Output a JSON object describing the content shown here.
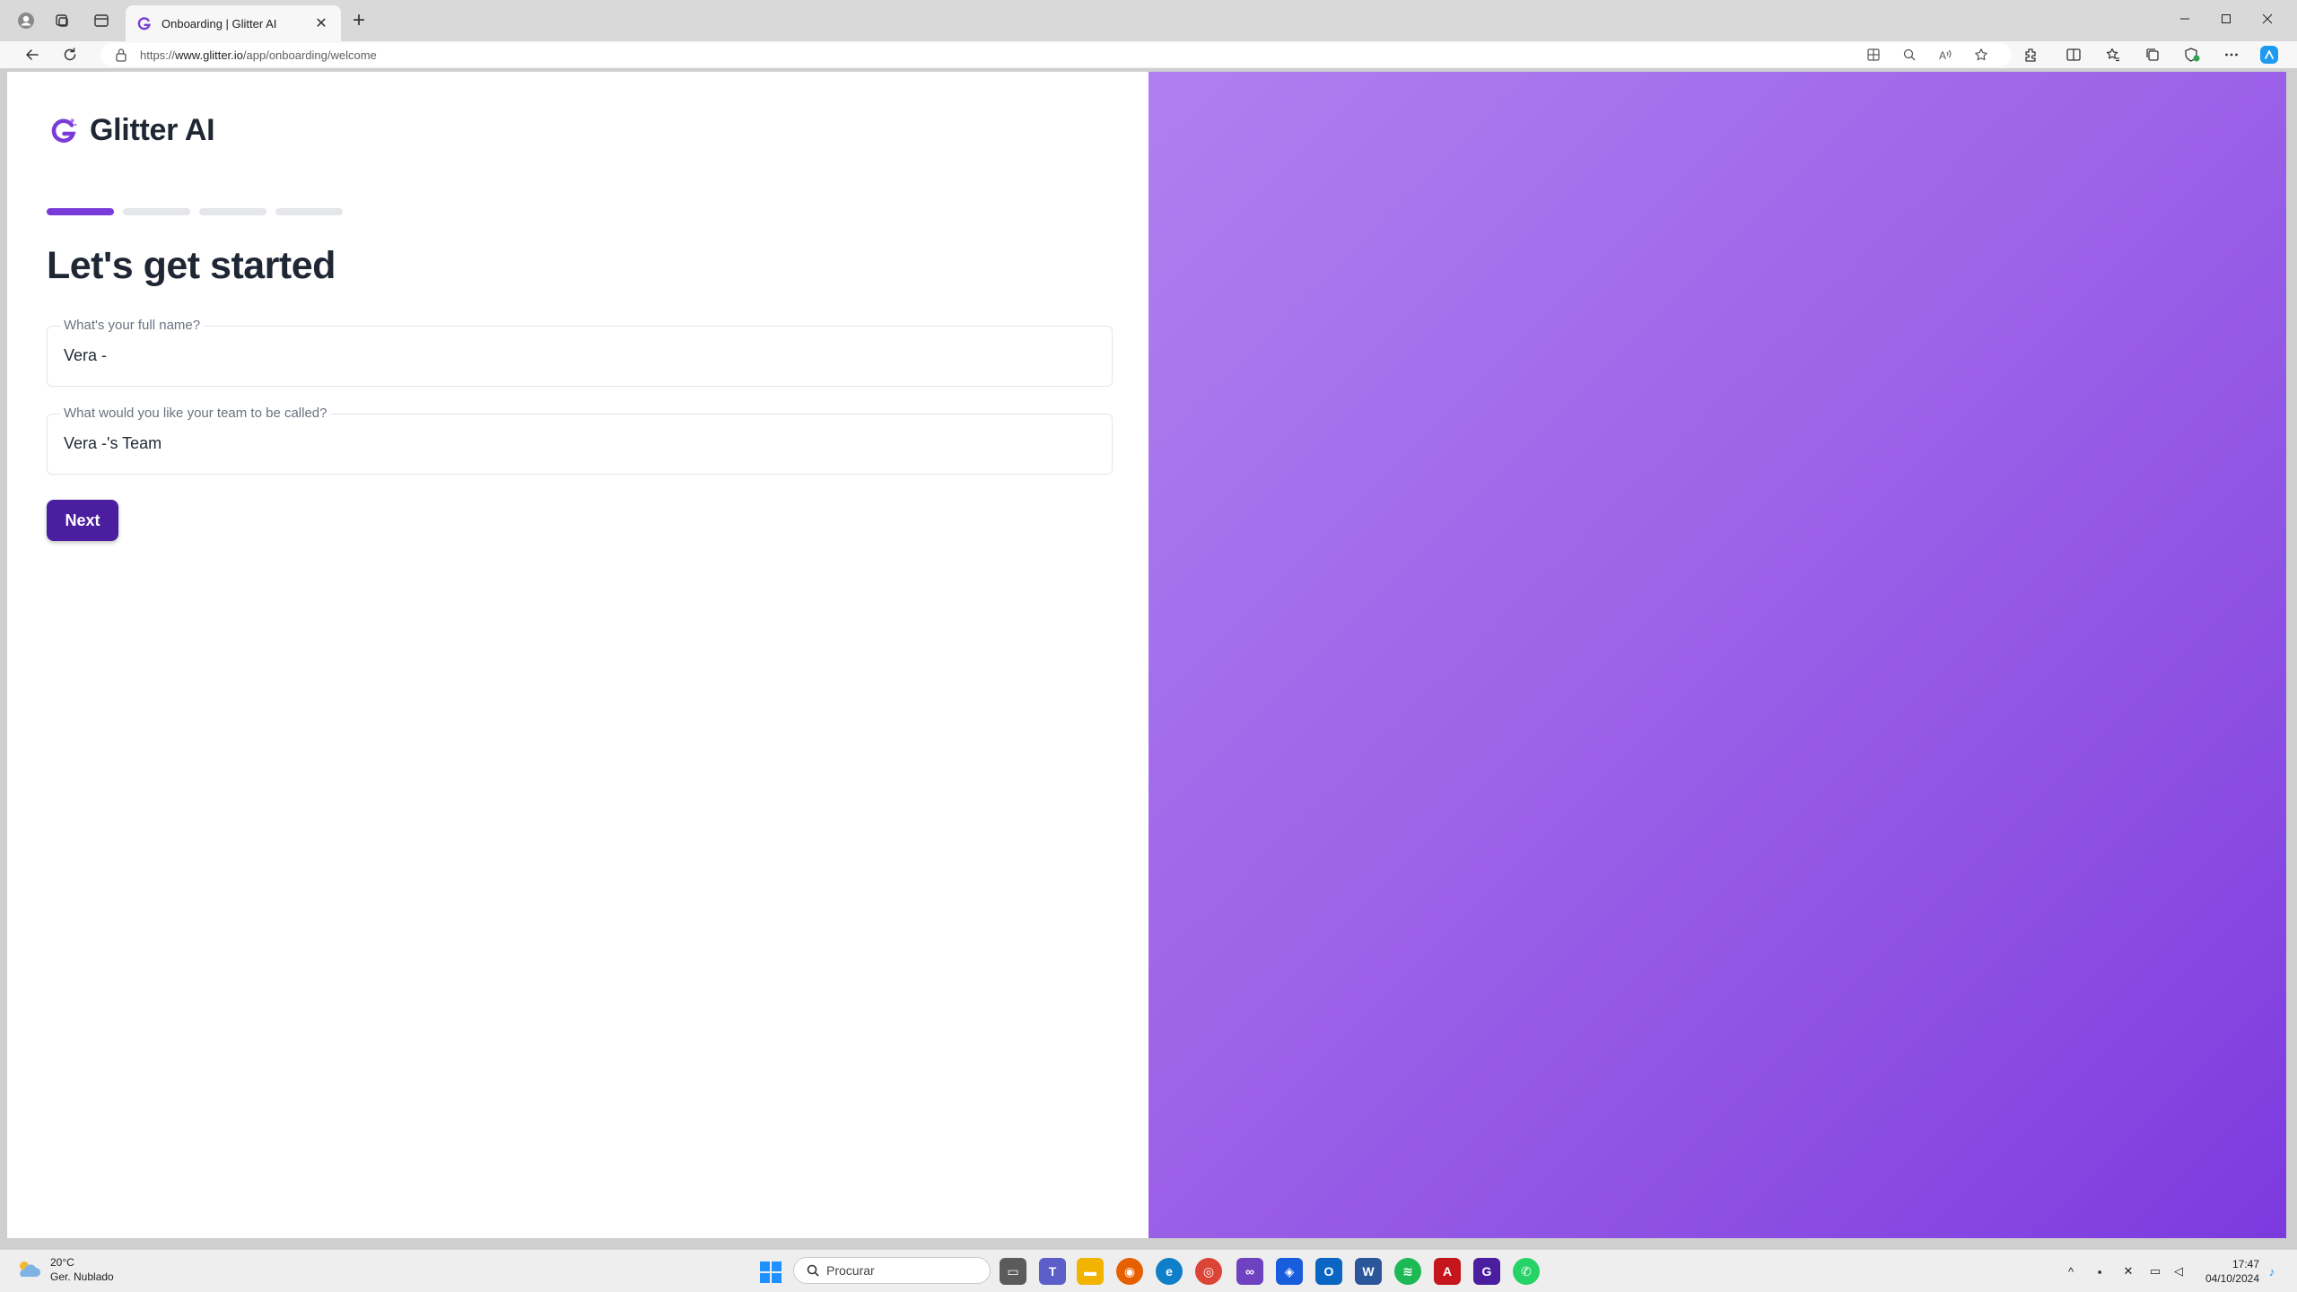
{
  "browser": {
    "tab_title": "Onboarding | Glitter AI",
    "url_prefix": "https://",
    "url_host": "www.glitter.io",
    "url_path": "/app/onboarding/welcome"
  },
  "page": {
    "brand": "Glitter AI",
    "brand_color": "#7a3bd8",
    "steps": {
      "total": 4,
      "current": 1
    },
    "heading": "Let's get started",
    "full_name": {
      "label": "What's your full name?",
      "value": "Vera -"
    },
    "team_name": {
      "label": "What would you like your team to be called?",
      "value": "Vera -'s Team"
    },
    "next_label": "Next",
    "button_color": "#4a1e9e",
    "panel_gradient": [
      "#b17ff0",
      "#7c3adf"
    ]
  },
  "taskbar": {
    "weather_temp": "20°C",
    "weather_desc": "Ger. Nublado",
    "search_placeholder": "Procurar",
    "time": "17:47",
    "date": "04/10/2024",
    "apps": [
      "file-explorer-icon",
      "teams-icon",
      "folder-icon",
      "firefox-icon",
      "edge-icon",
      "chrome-icon",
      "app-icon",
      "bitwarden-icon",
      "outlook-icon",
      "word-icon",
      "spotify-icon",
      "pdf-icon",
      "glitter-icon",
      "whatsapp-icon"
    ]
  }
}
